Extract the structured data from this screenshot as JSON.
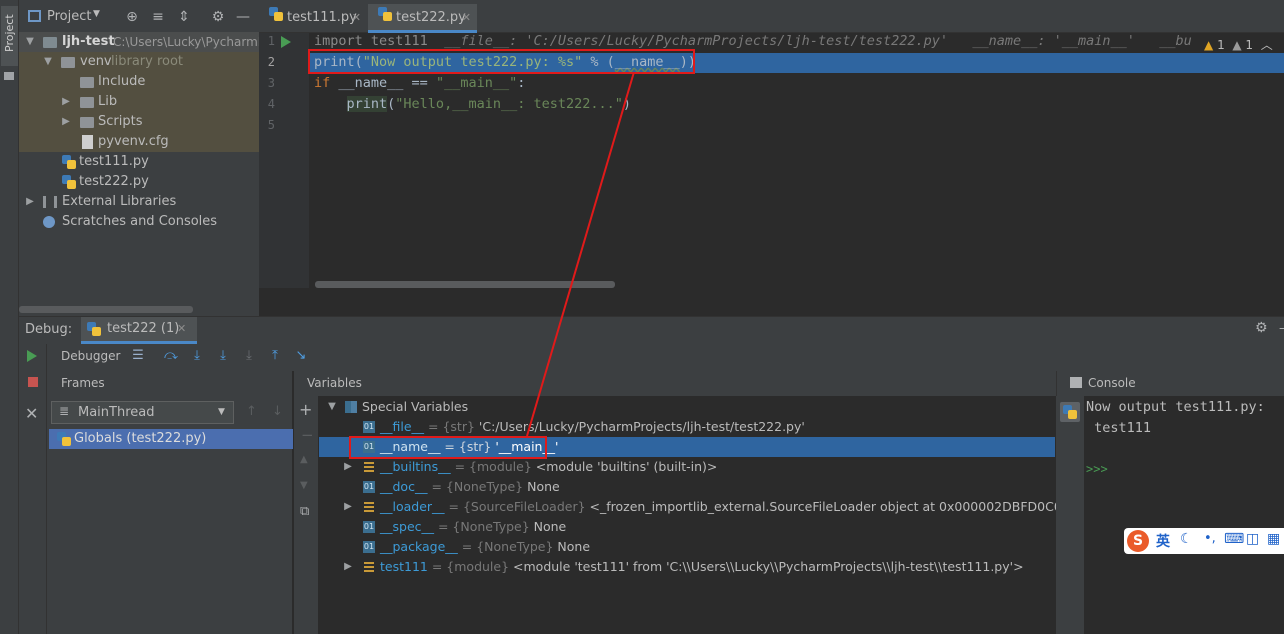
{
  "left_stripe": {
    "project_label": "Project"
  },
  "project_panel": {
    "title": "Project",
    "tree": {
      "root_name": "ljh-test",
      "root_path": "C:\\Users\\Lucky\\PycharmP",
      "venv_name": "venv",
      "venv_hint": "library root",
      "include": "Include",
      "lib": "Lib",
      "scripts": "Scripts",
      "pyvenv": "pyvenv.cfg",
      "test111": "test111.py",
      "test222": "test222.py",
      "external": "External Libraries",
      "scratches": "Scratches and Consoles"
    }
  },
  "editor": {
    "tabs": [
      {
        "label": "test111.py"
      },
      {
        "label": "test222.py"
      }
    ],
    "line_numbers": [
      "1",
      "2",
      "3",
      "4",
      "5"
    ],
    "line1": {
      "kw": "import",
      "rest": " test111",
      "hint": "  __file__: 'C:/Users/Lucky/PycharmProjects/ljh-test/test222.py'   __name__: '__main__'   __bu"
    },
    "line2": {
      "fn": "print",
      "open": "(",
      "str": "\"Now output test222.py: %s\"",
      "op": " % (",
      "name": "__name__",
      "close": "))"
    },
    "line3": {
      "kw": "if",
      "rest": " __name__ == ",
      "str": "\"__main__\"",
      "colon": ":"
    },
    "line4": {
      "indent": "    ",
      "fn": "print",
      "open": "(",
      "str": "\"Hello,__main__: test222...\"",
      "close": ")"
    },
    "warnings": {
      "w1": "1",
      "w2": "1"
    }
  },
  "debug": {
    "label": "Debug:",
    "session_tab": "test222 (1)",
    "debugger_tab": "Debugger",
    "frames_title": "Frames",
    "thread": "MainThread",
    "frame": "Globals (test222.py)",
    "variables_title": "Variables",
    "variables": [
      {
        "name": "Special Variables",
        "type": "",
        "value": ""
      },
      {
        "name": "__file__",
        "type": " = {str} ",
        "value": "'C:/Users/Lucky/PycharmProjects/ljh-test/test222.py'"
      },
      {
        "name": "__name__",
        "type": " = {str} ",
        "value": "'__main__'"
      },
      {
        "name": "__builtins__",
        "type": " = {module} ",
        "value": "<module 'builtins' (built-in)>"
      },
      {
        "name": "__doc__",
        "type": " = {NoneType} ",
        "value": "None"
      },
      {
        "name": "__loader__",
        "type": " = {SourceFileLoader} ",
        "value": "<_frozen_importlib_external.SourceFileLoader object at 0x000002DBFD0C0970>"
      },
      {
        "name": "__spec__",
        "type": " = {NoneType} ",
        "value": "None"
      },
      {
        "name": "__package__",
        "type": " = {NoneType} ",
        "value": "None"
      },
      {
        "name": "test111",
        "type": " = {module} ",
        "value": "<module 'test111' from 'C:\\\\Users\\\\Lucky\\\\PycharmProjects\\\\ljh-test\\\\test111.py'>"
      }
    ],
    "console_title": "Console",
    "console_output_1": "Now output test111.py:",
    "console_output_2": " test111",
    "console_prompt": ">>>"
  },
  "ime": {
    "char": "英"
  },
  "colors": {
    "selection": "#2f65a0",
    "annotation_red": "#e01a1a",
    "keyword": "#cc7832",
    "string": "#6a8759"
  }
}
